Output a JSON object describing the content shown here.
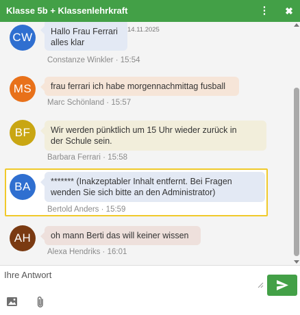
{
  "window": {
    "title": "Klasse 5b + Klassenlehrkraft",
    "menu_icon": "kebab-icon",
    "close_icon": "close-icon",
    "accent": "#43a047"
  },
  "messages": [
    {
      "initials": "CW",
      "avatar_color": "#2f6fd0",
      "bubble_color": "#e3e9f4",
      "lines": [
        "Hallo Frau Ferrari",
        "alles klar"
      ],
      "date": "14.11.2025",
      "author": "Constanze Winkler",
      "time": "15:54"
    },
    {
      "initials": "MS",
      "avatar_color": "#e8711a",
      "bubble_color": "#f6e5d8",
      "lines": [
        "frau ferrari ich habe morgennachmittag fusball"
      ],
      "author": "Marc Schönland",
      "time": "15:57"
    },
    {
      "initials": "BF",
      "avatar_color": "#c9a613",
      "bubble_color": "#f2eedb",
      "lines": [
        "Wir werden pünktlich um 15 Uhr wieder zurück in",
        "der Schule sein."
      ],
      "author": "Barbara Ferrari",
      "time": "15:58"
    },
    {
      "initials": "BA",
      "avatar_color": "#2f6fd0",
      "bubble_color": "#e3e9f4",
      "lines": [
        "******* (Inakzeptabler Inhalt entfernt. Bei Fragen",
        "wenden Sie sich bitte an den Administrator)"
      ],
      "author": "Bertold Anders",
      "time": "15:59",
      "highlighted": true,
      "highlight_color": "#f0c929"
    },
    {
      "initials": "AH",
      "avatar_color": "#7a3a12",
      "bubble_color": "#eee0dc",
      "lines": [
        "oh mann Berti das will keiner wissen"
      ],
      "author": "Alexa Hendriks",
      "time": "16:01"
    }
  ],
  "composer": {
    "placeholder": "Ihre Antwort",
    "send_icon": "send-icon",
    "image_icon": "image-icon",
    "attach_icon": "paperclip-icon"
  }
}
